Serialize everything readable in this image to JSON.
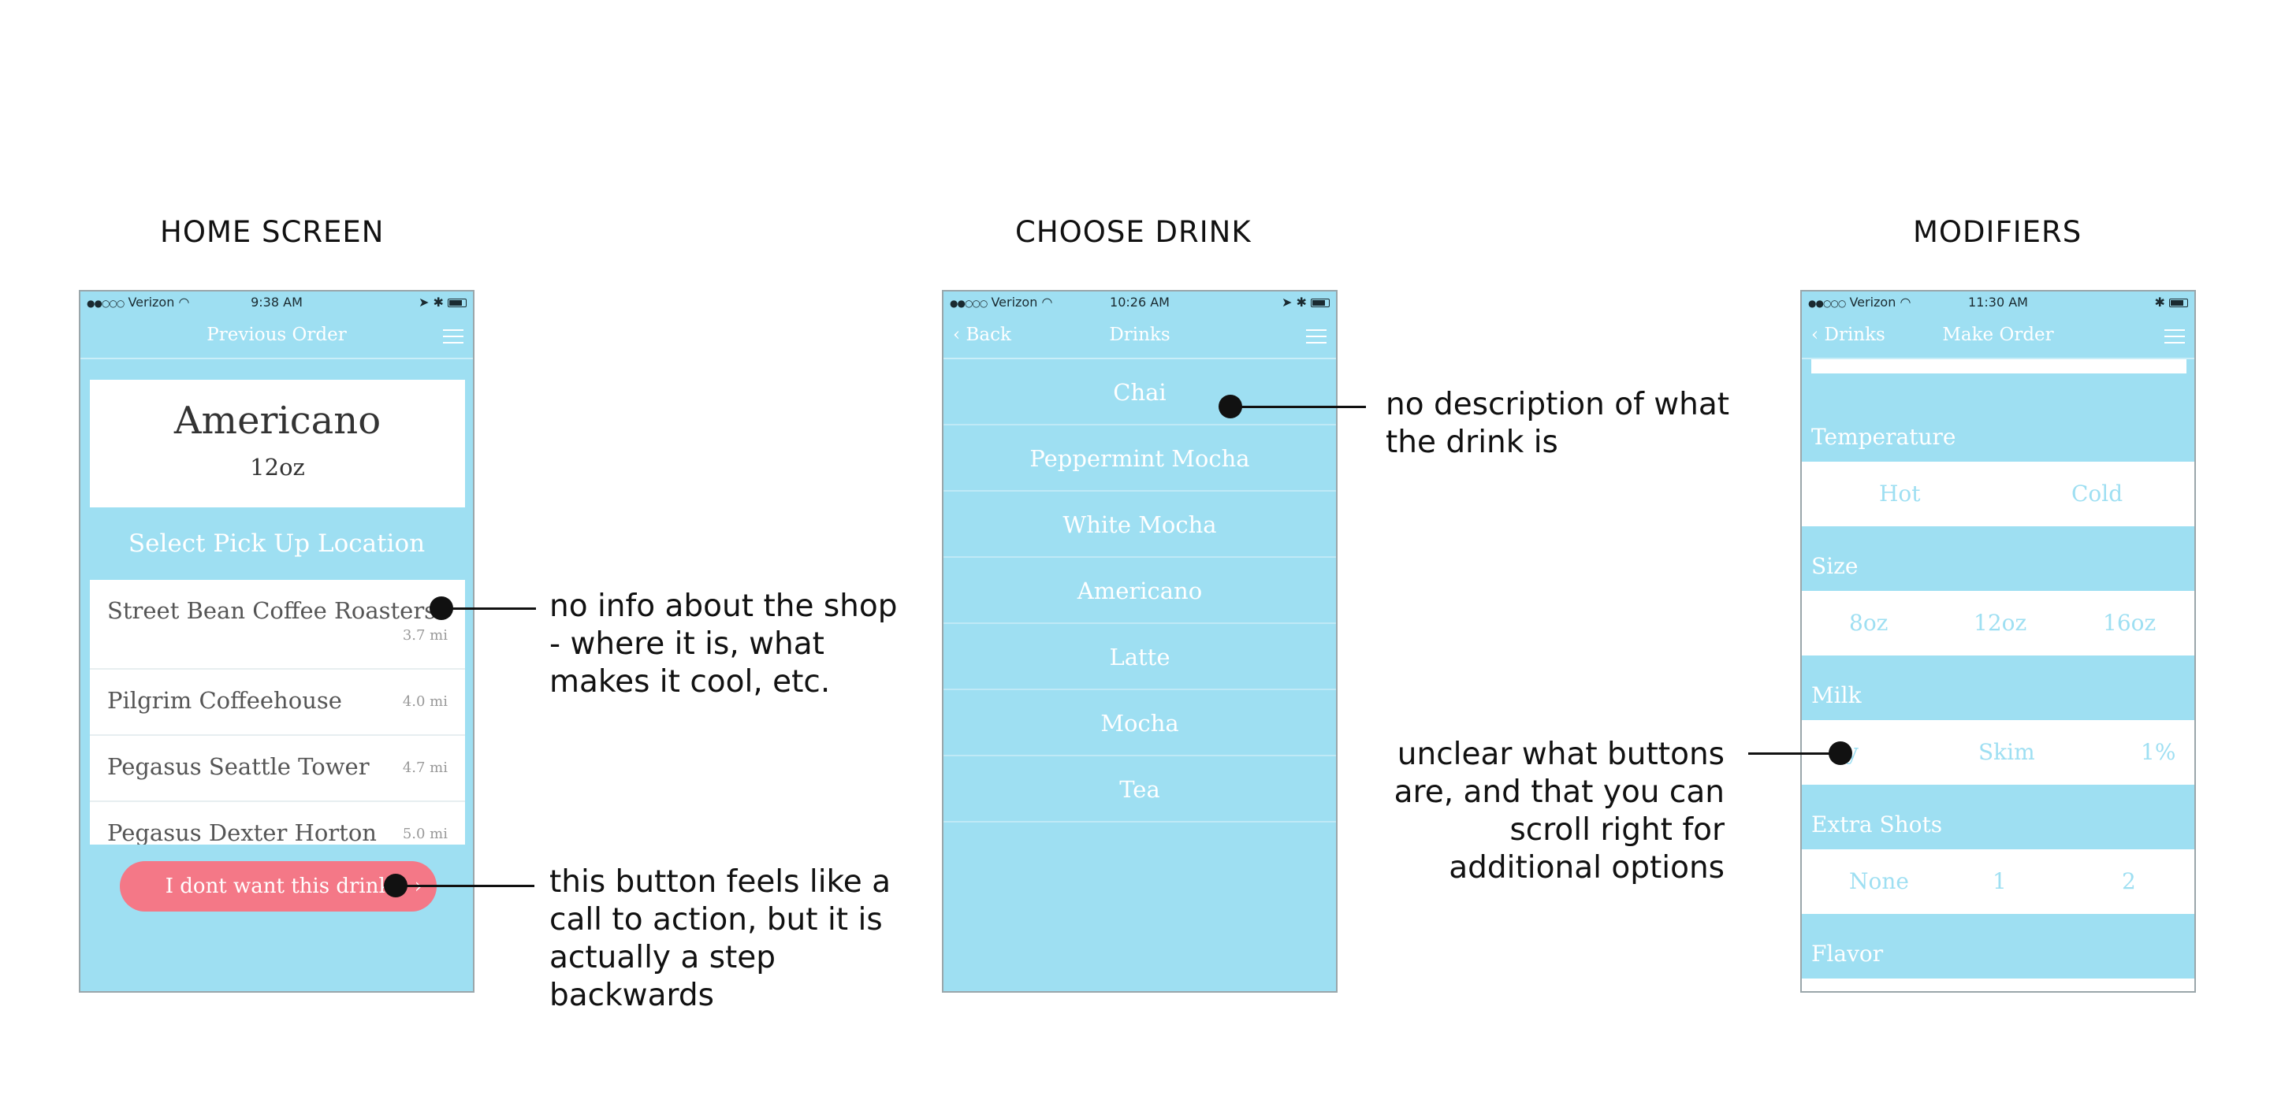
{
  "sections": {
    "home": "HOME SCREEN",
    "choose": "CHOOSE DRINK",
    "modifiers": "MODIFIERS"
  },
  "home": {
    "status": {
      "carrier": "Verizon",
      "time": "9:38 AM"
    },
    "nav_title": "Previous Order",
    "order_name": "Americano",
    "order_size": "12oz",
    "select_location": "Select Pick Up Location",
    "locations": [
      {
        "name": "Street Bean Coffee Roasters",
        "distance": "3.7 mi"
      },
      {
        "name": "Pilgrim Coffeehouse",
        "distance": "4.0 mi"
      },
      {
        "name": "Pegasus Seattle Tower",
        "distance": "4.7 mi"
      },
      {
        "name": "Pegasus Dexter Horton",
        "distance": "5.0 mi"
      }
    ],
    "cancel_button": "I dont want this drink"
  },
  "choose": {
    "status": {
      "carrier": "Verizon",
      "time": "10:26 AM"
    },
    "back_label": "Back",
    "nav_title": "Drinks",
    "drinks": [
      "Chai",
      "Peppermint Mocha",
      "White Mocha",
      "Americano",
      "Latte",
      "Mocha",
      "Tea"
    ]
  },
  "modifiers": {
    "status": {
      "carrier": "Verizon",
      "time": "11:30 AM"
    },
    "back_label": "Drinks",
    "nav_title": "Make Order",
    "groups": [
      {
        "label": "Temperature",
        "options": [
          "Hot",
          "Cold"
        ]
      },
      {
        "label": "Size",
        "options": [
          "8oz",
          "12oz",
          "16oz"
        ]
      },
      {
        "label": "Milk",
        "options": [
          "y",
          "Skim",
          "1%"
        ]
      },
      {
        "label": "Extra Shots",
        "options": [
          "None",
          "1",
          "2"
        ]
      },
      {
        "label": "Flavor",
        "options": []
      }
    ]
  },
  "annotations": {
    "shop_info": [
      "no info about the shop",
      "- where it is, what",
      "makes it cool, etc."
    ],
    "button_note": [
      "this button feels like a",
      "call to action, but it is",
      "actually a step",
      "backwards"
    ],
    "drink_description": [
      "no description of what",
      "the drink is"
    ],
    "buttons_unclear": [
      "unclear what buttons",
      "are, and that you can",
      "scroll right for",
      "additional options"
    ]
  },
  "colors": {
    "phone_bg": "#9edff2",
    "button_pink": "#f47887",
    "text_dark": "#111111"
  }
}
